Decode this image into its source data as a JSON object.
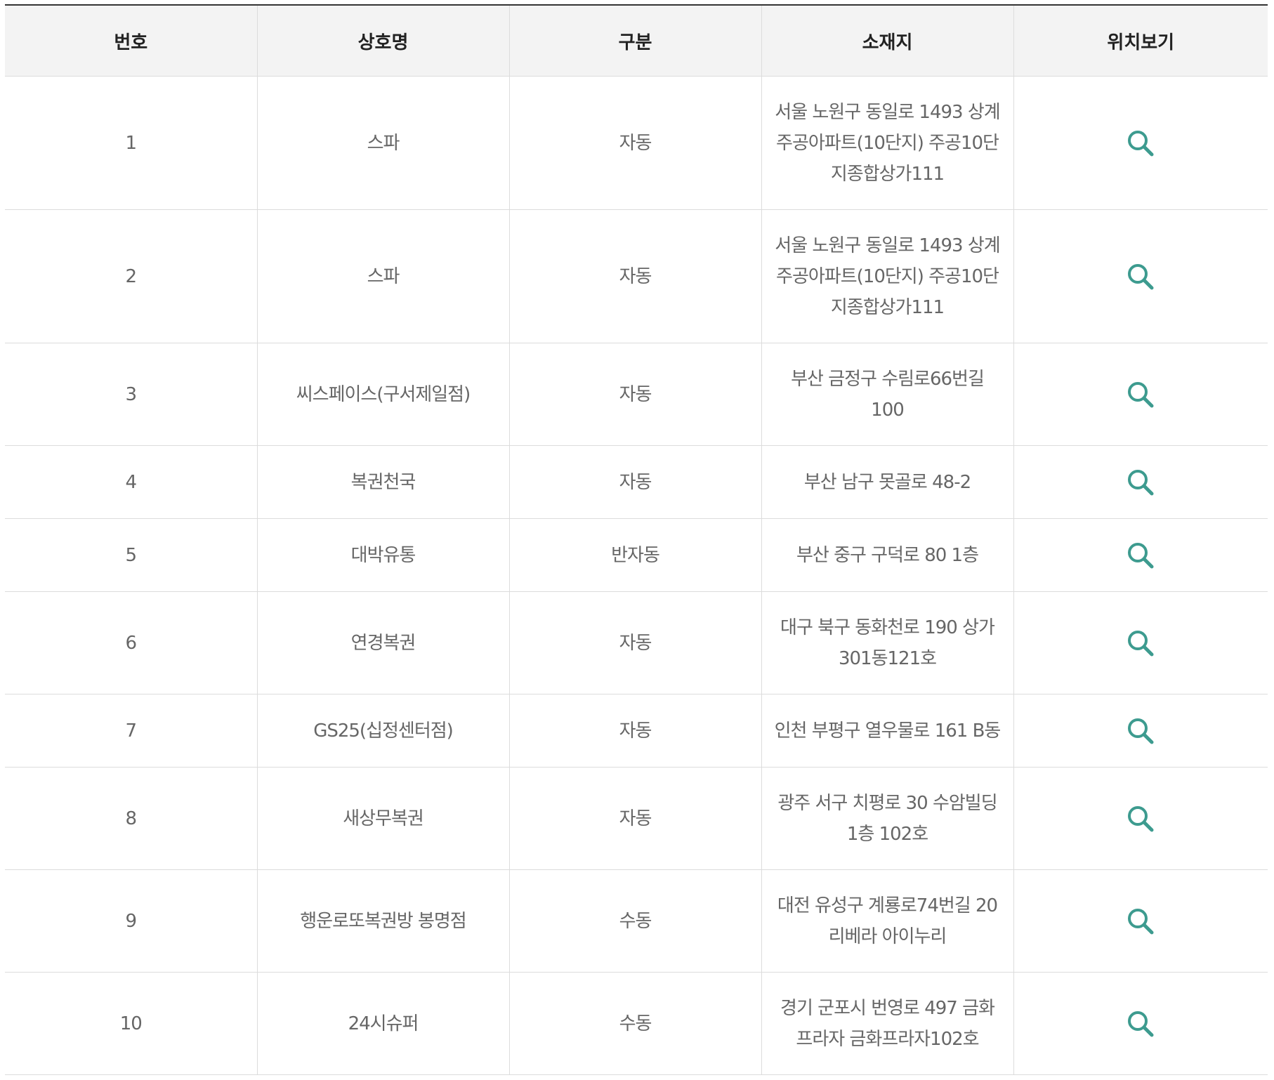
{
  "table": {
    "headers": [
      "번호",
      "상호명",
      "구분",
      "소재지",
      "위치보기"
    ],
    "rows": [
      {
        "no": "1",
        "name": "스파",
        "type": "자동",
        "address": "서울 노원구 동일로 1493 상계주공아파트(10단지) 주공10단지종합상가111"
      },
      {
        "no": "2",
        "name": "스파",
        "type": "자동",
        "address": "서울 노원구 동일로 1493 상계주공아파트(10단지) 주공10단지종합상가111"
      },
      {
        "no": "3",
        "name": "씨스페이스(구서제일점)",
        "type": "자동",
        "address": "부산 금정구 수림로66번길 100"
      },
      {
        "no": "4",
        "name": "복권천국",
        "type": "자동",
        "address": "부산 남구 못골로 48-2"
      },
      {
        "no": "5",
        "name": "대박유통",
        "type": "반자동",
        "address": "부산 중구 구덕로 80 1층"
      },
      {
        "no": "6",
        "name": "연경복권",
        "type": "자동",
        "address": "대구 북구 동화천로 190 상가301동121호"
      },
      {
        "no": "7",
        "name": "GS25(십정센터점)",
        "type": "자동",
        "address": "인천 부평구 열우물로 161 B동"
      },
      {
        "no": "8",
        "name": "새상무복권",
        "type": "자동",
        "address": "광주 서구 치평로 30 수암빌딩 1층 102호"
      },
      {
        "no": "9",
        "name": "행운로또복권방 봉명점",
        "type": "수동",
        "address": "대전 유성구 계룡로74번길 20 리베라 아이누리"
      },
      {
        "no": "10",
        "name": "24시슈퍼",
        "type": "수동",
        "address": "경기 군포시 번영로 497 금화프라자 금화프라자102호"
      }
    ]
  },
  "colors": {
    "accent": "#3d9b8f",
    "header_bg": "#f3f3f3",
    "border": "#dcdcdc"
  },
  "icons": {
    "location": "search-icon"
  }
}
